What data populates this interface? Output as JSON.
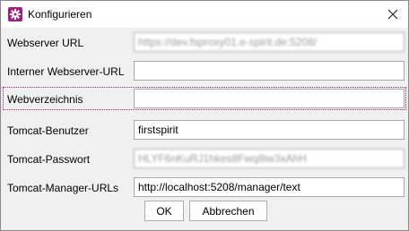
{
  "window": {
    "title": "Konfigurieren",
    "app_icon": "gear-icon",
    "close_icon": "close-icon"
  },
  "form": {
    "fields": [
      {
        "label": "Webserver URL",
        "value": "https://dev.fsproxy01.e-spirit.de:5208/",
        "blurred": true
      },
      {
        "label": "Interner Webserver-URL",
        "value": "",
        "blurred": false
      },
      {
        "label": "Webverzeichnis",
        "value": "",
        "blurred": false
      },
      {
        "label": "Tomcat-Benutzer",
        "value": "firstspirit",
        "blurred": false
      },
      {
        "label": "Tomcat-Passwort",
        "value": "HLYF6nKuRJ1hkes8Fwq8iw3xAhH",
        "blurred": true
      },
      {
        "label": "Tomcat-Manager-URLs",
        "value": "http://localhost:5208/manager/text",
        "blurred": false
      }
    ]
  },
  "buttons": {
    "ok": "OK",
    "cancel": "Abbrechen"
  },
  "colors": {
    "accent": "#a0207a"
  }
}
